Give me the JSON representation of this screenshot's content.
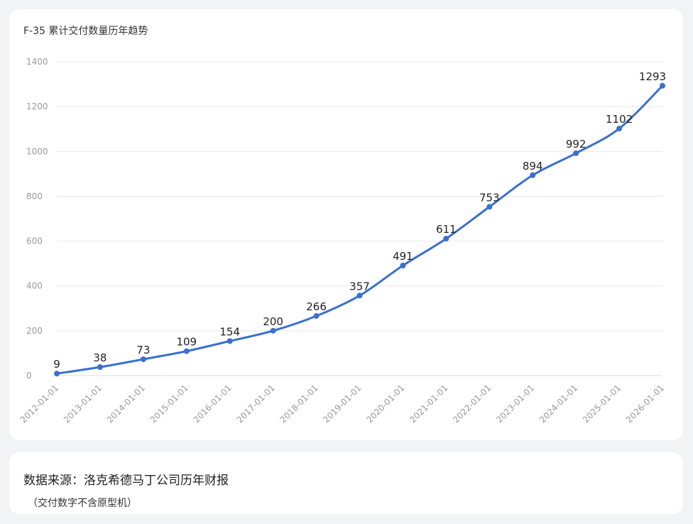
{
  "chart_data": {
    "type": "line",
    "title": "F-35 累计交付数量历年趋势",
    "x": [
      "2012-01-01",
      "2013-01-01",
      "2014-01-01",
      "2015-01-01",
      "2016-01-01",
      "2017-01-01",
      "2018-01-01",
      "2019-01-01",
      "2020-01-01",
      "2021-01-01",
      "2022-01-01",
      "2023-01-01",
      "2024-01-01",
      "2025-01-01",
      "2026-01-01"
    ],
    "series": [
      {
        "values": [
          9,
          38,
          73,
          109,
          154,
          200,
          266,
          357,
          491,
          611,
          753,
          894,
          992,
          1102,
          1293
        ]
      }
    ],
    "ylim": [
      0,
      1400
    ],
    "yticks": [
      0,
      200,
      400,
      600,
      800,
      1000,
      1200,
      1400
    ],
    "grid": true,
    "smooth": true,
    "data_labels": true,
    "line_color": "#3a6fcf"
  },
  "footer": {
    "source": "数据来源：洛克希德马丁公司历年财报",
    "note": "（交付数字不含原型机）"
  }
}
